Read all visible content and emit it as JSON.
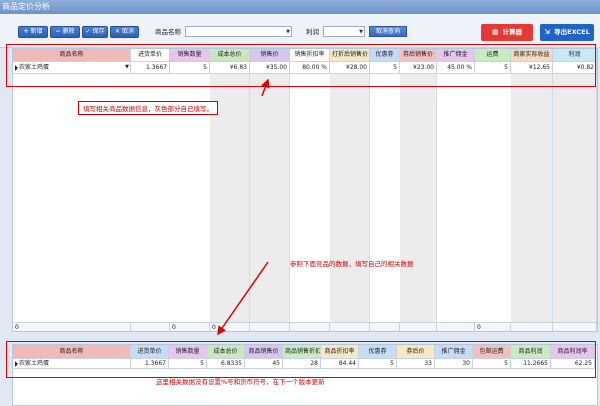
{
  "window": {
    "title": "商品定价分析"
  },
  "toolbar": {
    "add_label": "新增",
    "delete_label": "删除",
    "save_label": "保存",
    "cancel_label": "取消",
    "product_name_label": "商品名称",
    "product_name_value": "",
    "profit_label": "利润",
    "profit_value": "",
    "query_label": "取消查询",
    "calculator_label": "计算器",
    "export_label": "导出EXCEL"
  },
  "top_grid": {
    "headers": [
      "商品名称",
      "进货单价",
      "销售数量",
      "成本总价",
      "销售价",
      "销售折扣率",
      "打折后销售价",
      "优惠券",
      "券后销售价",
      "推广佣金",
      "运费",
      "商家实际收益",
      "利润"
    ],
    "header_colors": [
      "#f2b9b9",
      "#ffffff",
      "#e8c5ef",
      "#c9e8c0",
      "#d7c7ef",
      "#ffffff",
      "#f6e8c4",
      "#c6dcf4",
      "#f3c0c0",
      "#e5c6ee",
      "#c9ebc1",
      "#f6d8c0",
      "#c9e8f3"
    ],
    "rows": [
      [
        "农家土鸡蛋",
        "1.3667",
        "5",
        "¥6.83",
        "¥35.00",
        "80.00 %",
        "¥28.00",
        "5",
        "¥23.00",
        "45.00 %",
        "5",
        "¥12.65",
        "¥0.82"
      ]
    ],
    "footer": [
      "0",
      "",
      "0",
      "0",
      "",
      "",
      "",
      "",
      "",
      "",
      "0",
      "",
      ""
    ]
  },
  "bottom_grid": {
    "headers": [
      "商品名称",
      "进货单价",
      "销售数量",
      "成本总价",
      "商品销售价",
      "商品销售折扣",
      "商品折扣率",
      "优惠券",
      "券后价",
      "推广佣金",
      "包邮运费",
      "商品利润",
      "商品利润率"
    ],
    "header_colors": [
      "#f2b9b9",
      "#c6dcf4",
      "#e8c5ef",
      "#c9e8c0",
      "#d7c7ef",
      "#c9ebc1",
      "#f6e8c4",
      "#c6dcf4",
      "#f6e8c4",
      "#c6dcf4",
      "#f3c0c0",
      "#c9ebc1",
      "#e8c5ef"
    ],
    "rows": [
      [
        "农家土鸡蛋",
        "1.3667",
        "5",
        "6.8335",
        "45",
        "28",
        "84.44",
        "5",
        "33",
        "30",
        "5",
        "11.2665",
        "62.25"
      ]
    ]
  },
  "annotations": {
    "note_top": "填写相关商品数据信息，灰色部分自己填写。",
    "note_middle": "参照下面竞品的数据，填写自己的相关数据",
    "note_bottom": "这里相关数据没有设置%号和货币符号，在下一个版本更新"
  },
  "colors": {
    "annotation": "#d40000",
    "toolbar_button": "#2e5fb3",
    "calculator": "#e53935",
    "export": "#1e63c6"
  }
}
